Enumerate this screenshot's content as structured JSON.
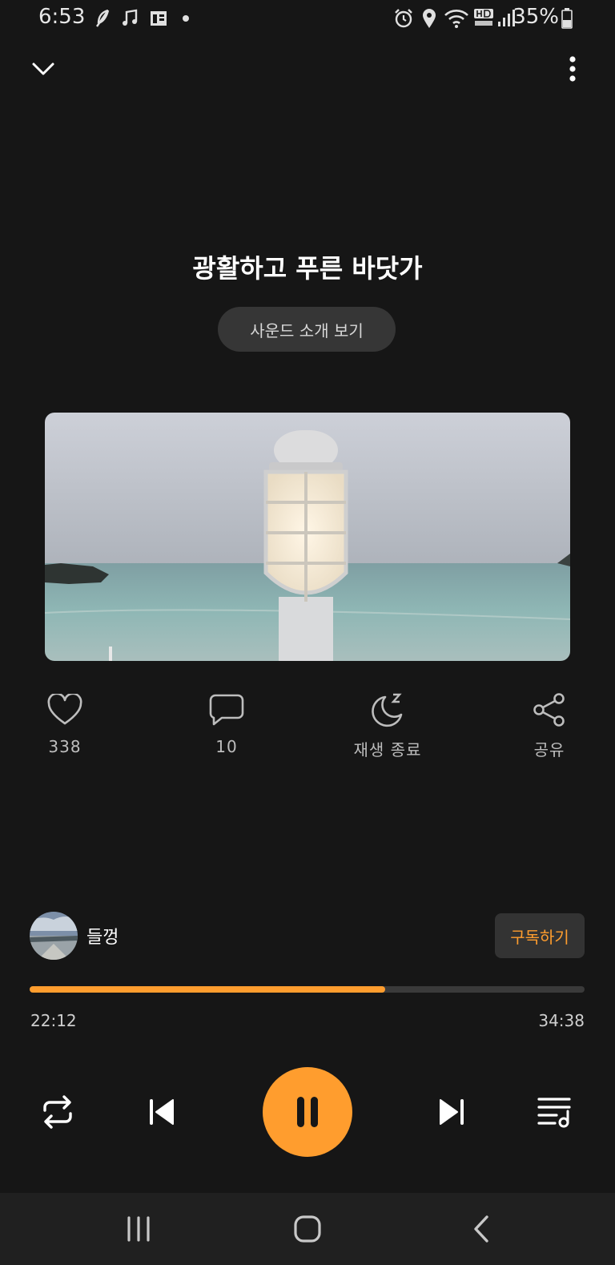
{
  "status_bar": {
    "time": "6:53",
    "battery": "35%"
  },
  "header": {
    "back_icon": "chevron-down-icon",
    "more_icon": "more-vertical-icon"
  },
  "track": {
    "title": "광활하고 푸른 바닷가",
    "intro_button_label": "사운드 소개 보기"
  },
  "actions": {
    "like": {
      "icon": "heart-icon",
      "label": "338"
    },
    "comment": {
      "icon": "comment-icon",
      "label": "10"
    },
    "sleep": {
      "icon": "moon-icon",
      "label": "재생 종료"
    },
    "share": {
      "icon": "share-icon",
      "label": "공유"
    }
  },
  "channel": {
    "name": "들껑",
    "subscribe_label": "구독하기"
  },
  "progress": {
    "elapsed": "22:12",
    "total": "34:38",
    "fraction": 0.641
  },
  "colors": {
    "background": "#161616",
    "accent": "#ff9d2e",
    "navbar": "#202020"
  },
  "controls": {
    "repeat_icon": "repeat-icon",
    "previous_icon": "skip-previous-icon",
    "pause_icon": "pause-icon",
    "next_icon": "skip-next-icon",
    "playlist_icon": "playlist-icon"
  }
}
